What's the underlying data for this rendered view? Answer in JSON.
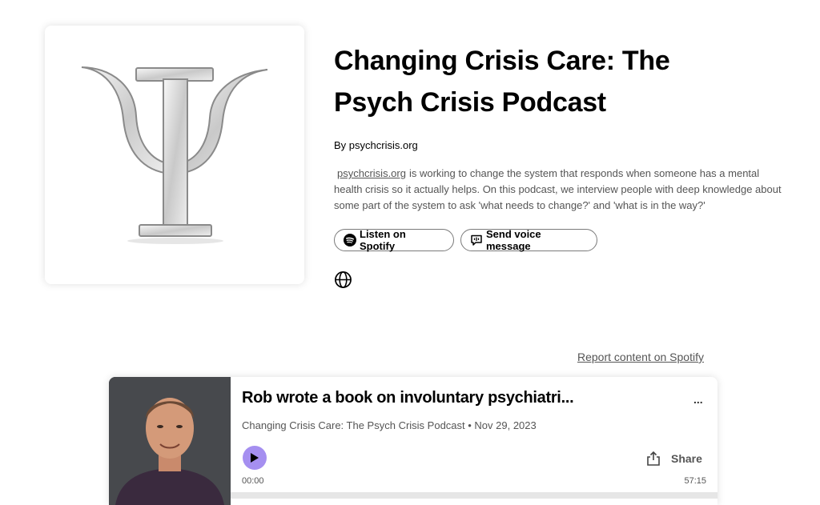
{
  "show": {
    "title": "Changing Crisis Care: The Psych Crisis Podcast",
    "byline": "By psychcrisis.org",
    "description_link": "psychcrisis.org",
    "description_text": "is working to change the system that responds when someone has a mental health crisis so it actually helps. On this podcast, we interview people with deep knowledge about some part of the system to ask 'what needs to change?' and 'what is in the way?'",
    "cover_icon": "psi-symbol-icon"
  },
  "actions": {
    "listen_label": "Listen on Spotify",
    "voice_label": "Send voice message",
    "globe_icon": "globe-icon"
  },
  "report_link": "Report content on Spotify",
  "episode": {
    "title": "Rob wrote a book on involuntary psychiatri...",
    "more_label": "...",
    "meta": "Changing Crisis Care: The Psych Crisis Podcast • Nov 29, 2023",
    "share_label": "Share",
    "time_current": "00:00",
    "time_total": "57:15",
    "progress": 0
  },
  "colors": {
    "accent": "#a58ff0",
    "text_secondary": "#555555"
  }
}
